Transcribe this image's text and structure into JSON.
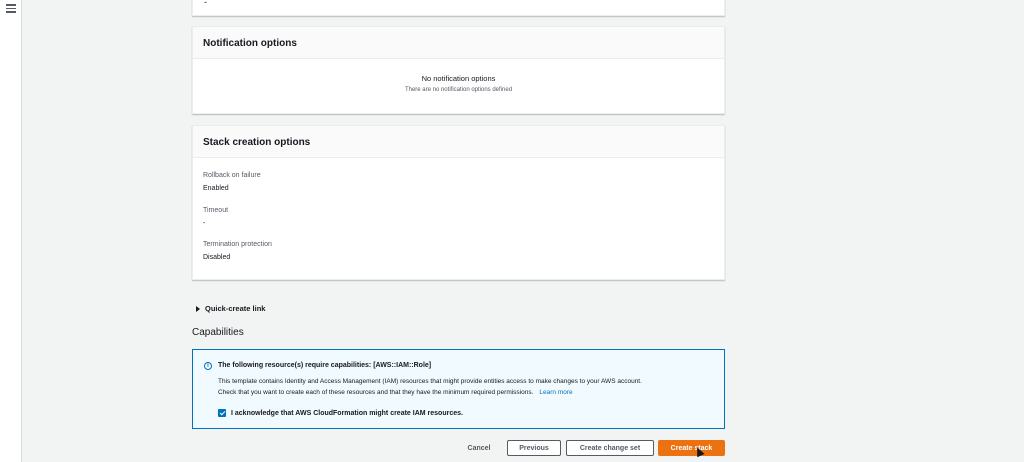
{
  "top_panel": {
    "value": "-"
  },
  "notification_options": {
    "title": "Notification options",
    "empty_title": "No notification options",
    "empty_subtitle": "There are no notification options defined"
  },
  "stack_creation_options": {
    "title": "Stack creation options",
    "fields": [
      {
        "label": "Rollback on failure",
        "value": "Enabled"
      },
      {
        "label": "Timeout",
        "value": "-"
      },
      {
        "label": "Termination protection",
        "value": "Disabled"
      }
    ]
  },
  "quick_create_link": {
    "label": "Quick-create link"
  },
  "capabilities": {
    "heading": "Capabilities",
    "alert_title": "The following resource(s) require capabilities: [AWS::IAM::Role]",
    "alert_body_line1": "This template contains Identity and Access Management (IAM) resources that might provide entities access to make changes to your AWS account.",
    "alert_body_line2": "Check that you want to create each of these resources and that they have the minimum required permissions.",
    "learn_more": "Learn more",
    "acknowledge_label": "I acknowledge that AWS CloudFormation might create IAM resources.",
    "acknowledge_checked": true
  },
  "actions": {
    "cancel": "Cancel",
    "previous": "Previous",
    "create_change_set": "Create change set",
    "create_stack": "Create stack"
  },
  "colors": {
    "primary": "#ec7211",
    "info": "#0073bb",
    "info_bg": "#f1faff",
    "page_bg": "#f2f3f3"
  }
}
